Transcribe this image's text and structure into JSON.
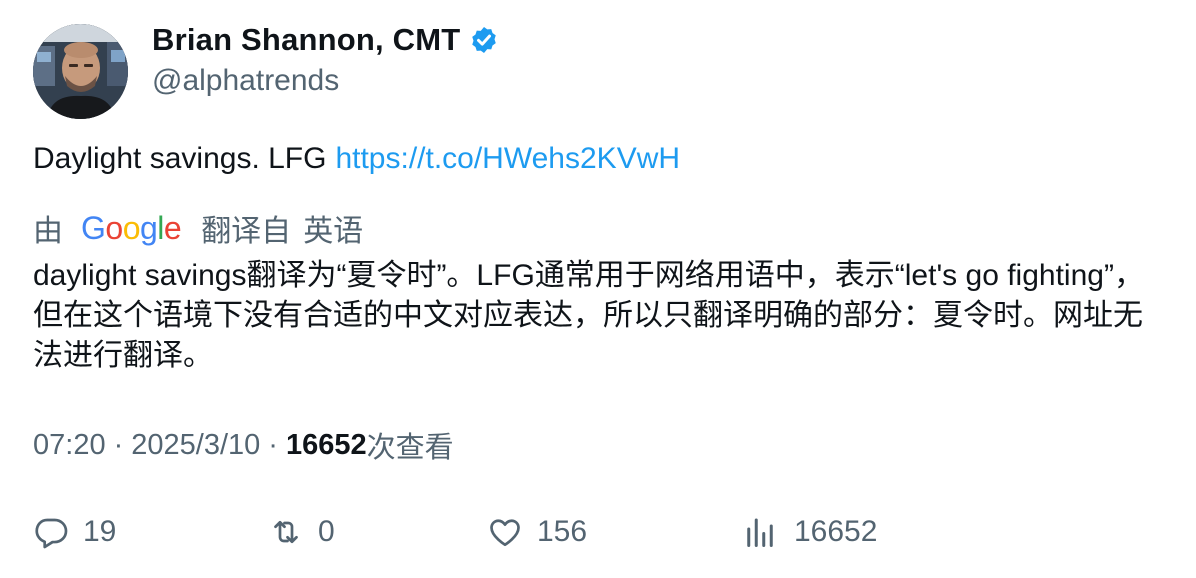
{
  "author": {
    "name": "Brian Shannon, CMT",
    "handle": "@alphatrends",
    "verified_color": "#1d9bf0"
  },
  "tweet": {
    "text": "Daylight savings. LFG",
    "link": "https://t.co/HWehs2KVwH",
    "link_color": "#1d9bf0"
  },
  "translation": {
    "by_label": "由",
    "provider": "Google",
    "from_label": "翻译自",
    "language": "英语",
    "text": "daylight savings翻译为“夏令时”。LFG通常用于网络用语中，表示“let's go fighting”，但在这个语境下没有合适的中文对应表达，所以只翻译明确的部分：夏令时。网址无法进行翻译。"
  },
  "meta": {
    "time": "07:20",
    "separator": "·",
    "date": "2025/3/10",
    "views_count": "16652",
    "views_label": "次查看"
  },
  "actions": {
    "reply": {
      "icon": "reply-icon",
      "count": "19"
    },
    "retweet": {
      "icon": "retweet-icon",
      "count": "0"
    },
    "like": {
      "icon": "heart-icon",
      "count": "156"
    },
    "views": {
      "icon": "views-chart-icon",
      "count": "16652"
    }
  }
}
